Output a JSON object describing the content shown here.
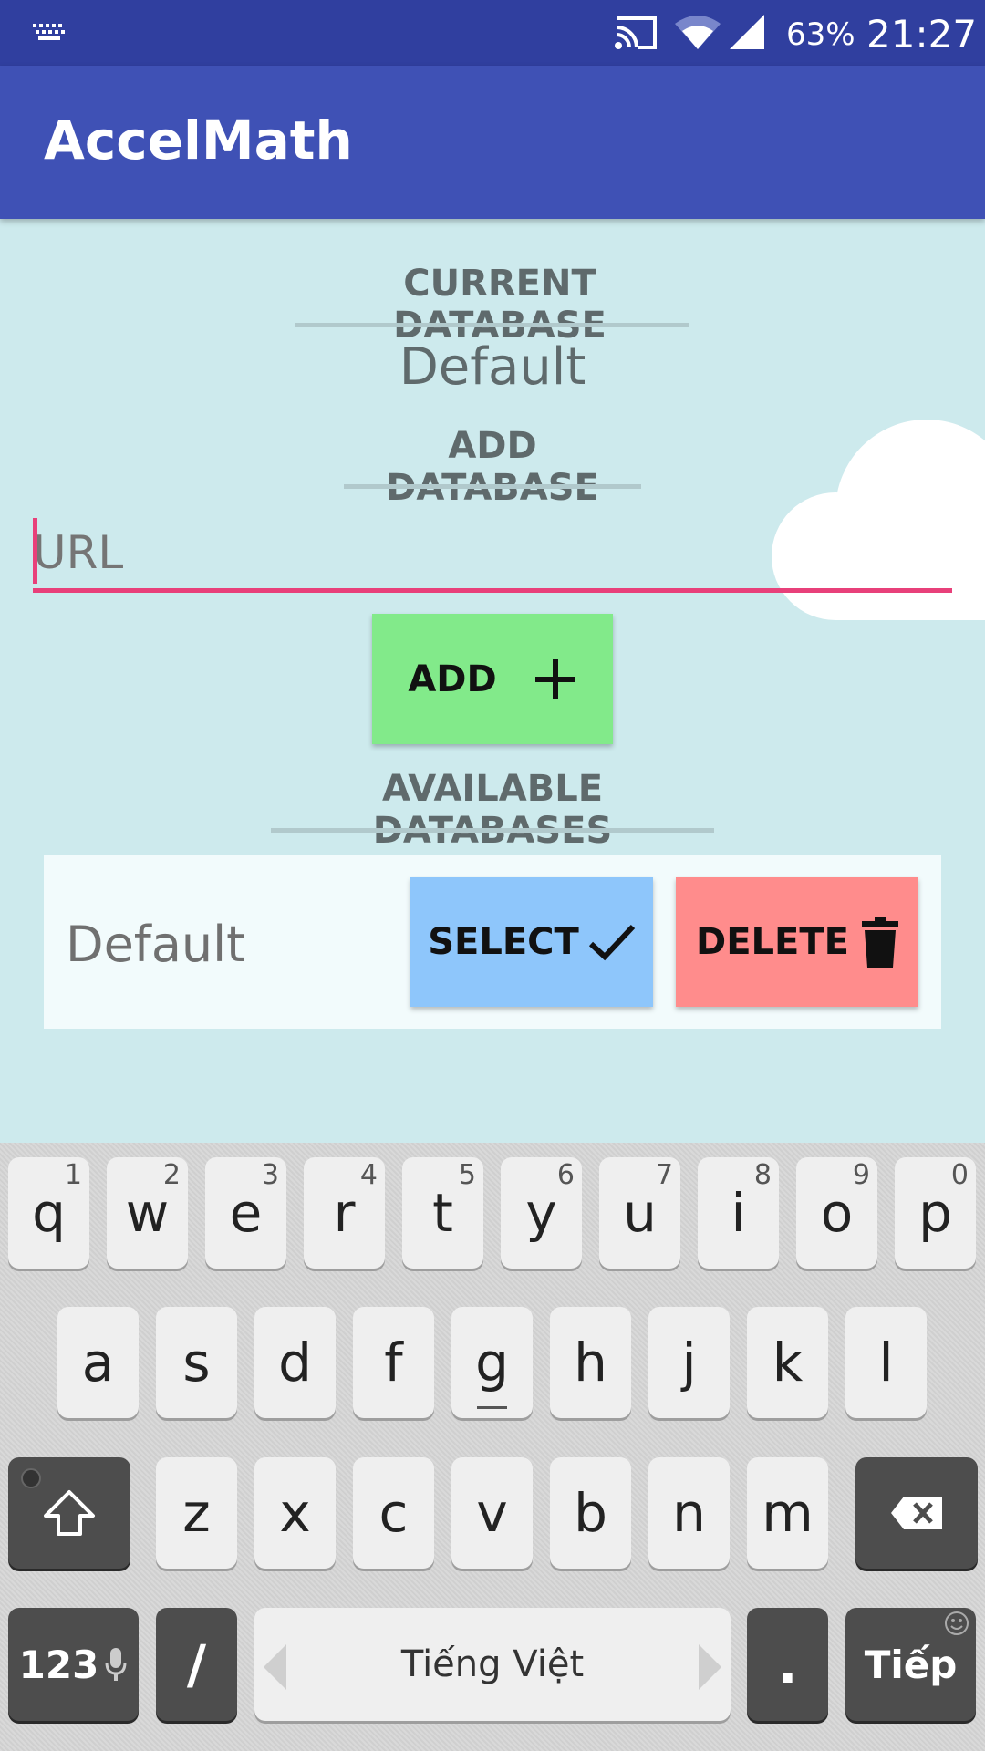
{
  "status_bar": {
    "battery": "63%",
    "clock": "21:27"
  },
  "app_bar": {
    "title": "AccelMath"
  },
  "current_database": {
    "header": "CURRENT DATABASE",
    "value": "Default"
  },
  "add_database": {
    "header": "ADD DATABASE",
    "url_placeholder": "URL",
    "url_value": "",
    "add_label": "ADD"
  },
  "available_databases": {
    "header": "AVAILABLE DATABASES",
    "items": [
      {
        "name": "Default",
        "select_label": "SELECT",
        "delete_label": "DELETE"
      }
    ]
  },
  "colors": {
    "status_bar": "#303f9f",
    "app_bar": "#3f51b5",
    "background": "#cdeaed",
    "add_button": "#82ea8a",
    "select_button": "#8ec6fb",
    "delete_button": "#ff8c8c",
    "input_accent": "#e8407a"
  },
  "keyboard": {
    "row1": [
      {
        "k": "q",
        "h": "1"
      },
      {
        "k": "w",
        "h": "2"
      },
      {
        "k": "e",
        "h": "3"
      },
      {
        "k": "r",
        "h": "4"
      },
      {
        "k": "t",
        "h": "5"
      },
      {
        "k": "y",
        "h": "6"
      },
      {
        "k": "u",
        "h": "7"
      },
      {
        "k": "i",
        "h": "8"
      },
      {
        "k": "o",
        "h": "9"
      },
      {
        "k": "p",
        "h": "0"
      }
    ],
    "row2": [
      "a",
      "s",
      "d",
      "f",
      "g",
      "h",
      "j",
      "k",
      "l"
    ],
    "row3": [
      "z",
      "x",
      "c",
      "v",
      "b",
      "n",
      "m"
    ],
    "symbols_label": "123",
    "slash_label": "/",
    "space_label": "Tiếng Việt",
    "period_label": ".",
    "enter_label": "Tiếp"
  }
}
